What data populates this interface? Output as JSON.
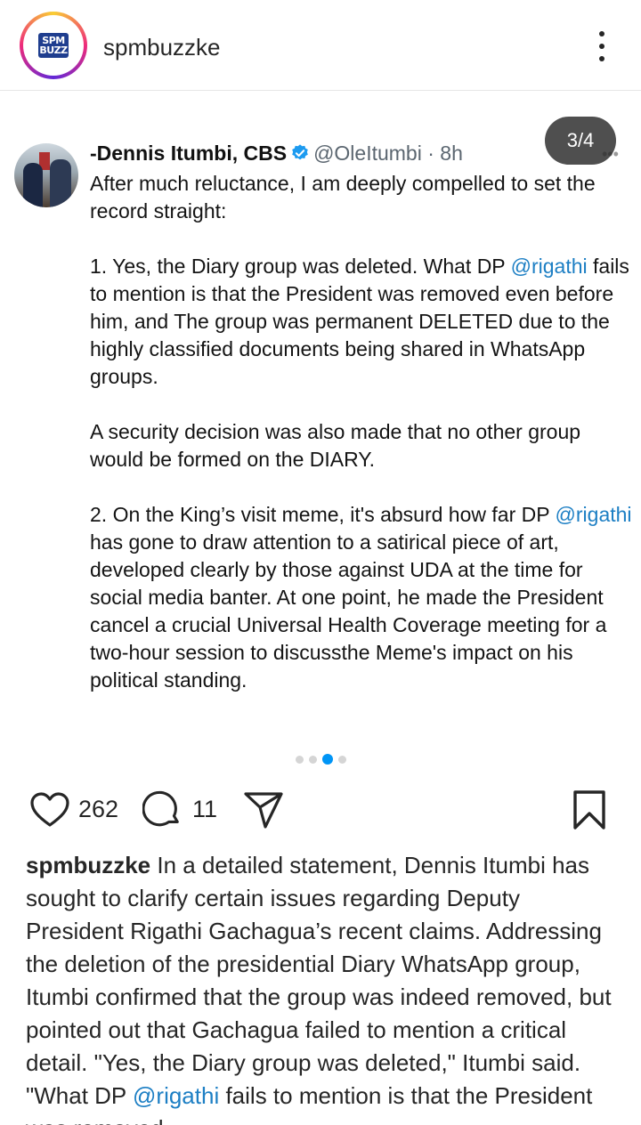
{
  "header": {
    "username": "spmbuzzke",
    "logo_text": "SPM BUZZ"
  },
  "media": {
    "counter": "3/4",
    "tweet": {
      "name": "-Dennis Itumbi, CBS",
      "handle": "@OleItumbi · 8h",
      "paragraphs": [
        [
          {
            "t": "After much reluctance, I am deeply compelled to set the record straight:"
          }
        ],
        [
          {
            "t": "1. Yes, the Diary group was deleted. What DP "
          },
          {
            "t": "@rigathi",
            "m": true
          },
          {
            "t": " fails to mention is that the President was removed even before him, and The group was permanent DELETED due to the highly classified documents being shared in WhatsApp groups."
          }
        ],
        [
          {
            "t": "A security decision was also made that no other group would be formed on the DIARY."
          }
        ],
        [
          {
            "t": "2. On the King’s visit meme, it's absurd how far DP "
          },
          {
            "t": "@rigathi",
            "m": true
          },
          {
            "t": " has gone to draw attention to a satirical piece of art, developed clearly by those against UDA at the time for social media  banter. At one point, he made the President cancel a crucial Universal Health Coverage meeting for a two-hour session to discussthe Meme's impact on his political standing."
          }
        ]
      ]
    },
    "carousel": {
      "total": 4,
      "active_index": 2
    }
  },
  "actions": {
    "likes": "262",
    "comments": "11"
  },
  "caption": {
    "username": "spmbuzzke",
    "text_before_mention": " In a detailed statement, Dennis Itumbi has sought to clarify certain issues regarding Deputy President Rigathi Gachagua’s recent claims. Addressing the deletion of the presidential Diary WhatsApp group, Itumbi confirmed that the group was indeed removed, but pointed out that Gachagua failed to mention a critical detail. \"Yes, the Diary group was deleted,\" Itumbi said. \"What DP ",
    "mention": "@rigathi",
    "text_after_mention": " fails to mention is that the President was removed"
  },
  "colors": {
    "mention": "#1d7fc4",
    "carousel_active": "#0095f6",
    "verified": "#1d9bf0"
  }
}
